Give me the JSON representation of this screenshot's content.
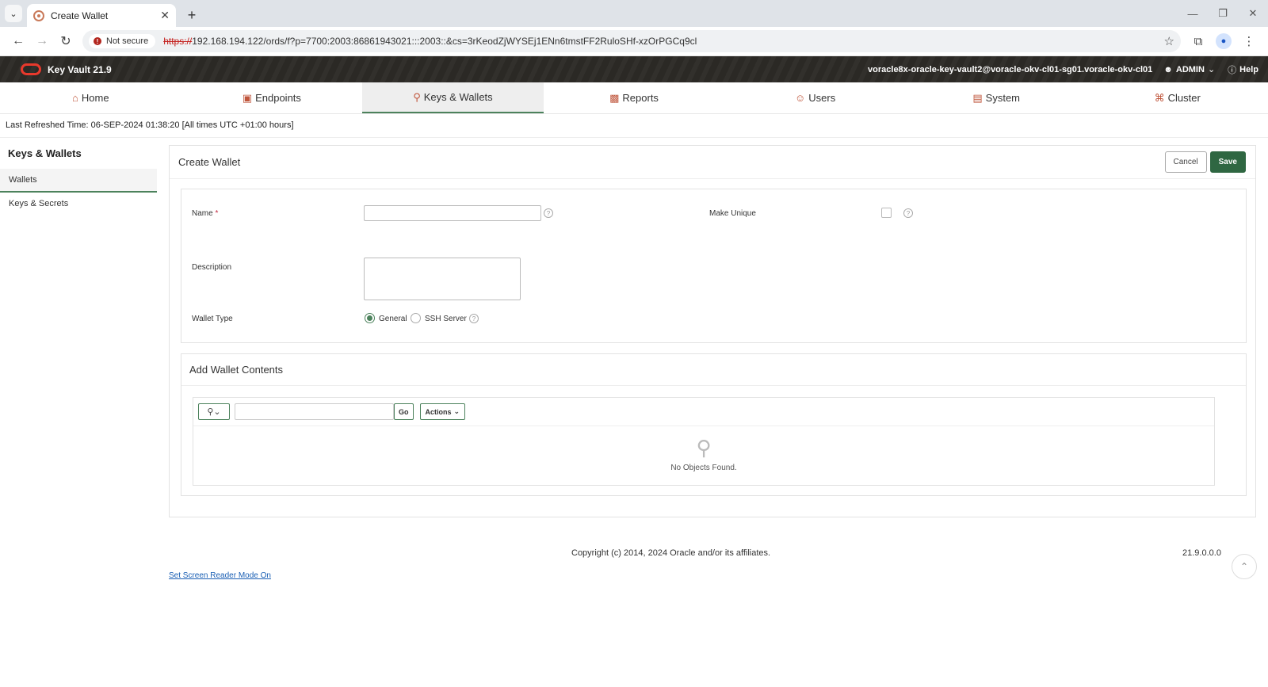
{
  "browser": {
    "tab_title": "Create Wallet",
    "security_label": "Not secure",
    "url_scheme": "https://",
    "url_rest": "192.168.194.122/ords/f?p=7700:2003:86861943021:::2003::&cs=3rKeodZjWYSEj1ENn6tmstFF2RuloSHf-xzOrPGCq9cl"
  },
  "header": {
    "app_title": "Key Vault 21.9",
    "user_host": "voracle8x-oracle-key-vault2@voracle-okv-cl01-sg01.voracle-okv-cl01",
    "admin_label": "ADMIN",
    "help_label": "Help"
  },
  "nav": {
    "items": [
      {
        "label": "Home",
        "icon": "home-icon"
      },
      {
        "label": "Endpoints",
        "icon": "monitor-icon"
      },
      {
        "label": "Keys & Wallets",
        "icon": "key-icon"
      },
      {
        "label": "Reports",
        "icon": "bar-chart-icon"
      },
      {
        "label": "Users",
        "icon": "users-icon"
      },
      {
        "label": "System",
        "icon": "system-icon"
      },
      {
        "label": "Cluster",
        "icon": "cluster-icon"
      }
    ],
    "active": "Keys & Wallets"
  },
  "refresh_text": "Last Refreshed Time: 06-SEP-2024 01:38:20 [All times UTC +01:00 hours]",
  "sidebar": {
    "title": "Keys & Wallets",
    "items": [
      {
        "label": "Wallets"
      },
      {
        "label": "Keys & Secrets"
      }
    ]
  },
  "form": {
    "title": "Create Wallet",
    "cancel_label": "Cancel",
    "save_label": "Save",
    "name_label": "Name",
    "name_value": "",
    "make_unique_label": "Make Unique",
    "description_label": "Description",
    "wallet_type_label": "Wallet Type",
    "wallet_type_options": [
      "General",
      "SSH Server"
    ],
    "wallet_type_selected": "General"
  },
  "contents": {
    "title": "Add Wallet Contents",
    "go_label": "Go",
    "actions_label": "Actions",
    "empty_message": "No Objects Found."
  },
  "footer": {
    "copyright": "Copyright (c) 2014, 2024 Oracle and/or its affiliates.",
    "version": "21.9.0.0.0",
    "screen_reader_link": "Set Screen Reader Mode On"
  },
  "colors": {
    "accent_green": "#2f6742",
    "tab_underline": "#4c825c",
    "nav_icon": "#c0563c",
    "header_bg": "#2b2925"
  }
}
